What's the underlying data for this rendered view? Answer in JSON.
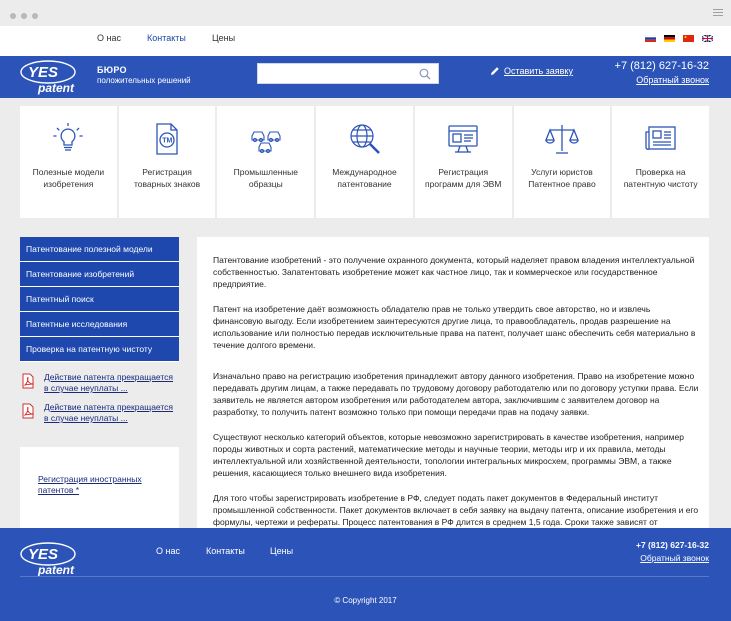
{
  "nav": {
    "about": "О нас",
    "contacts": "Контакты",
    "prices": "Цены"
  },
  "brand": {
    "logo_text_top": "YES",
    "logo_text_bottom": "patent",
    "title": "БЮРО",
    "subtitle": "положительных решений"
  },
  "header": {
    "request_label": "Оставить заявку",
    "phone": "+7 (812) 627-16-32",
    "callback": "Обратный звонок"
  },
  "services": [
    {
      "icon": "lightbulb-icon",
      "label": "Полезные модели изобретения"
    },
    {
      "icon": "trademark-document-icon",
      "label": "Регистрация товарных знаков"
    },
    {
      "icon": "cars-icon",
      "label": "Промышленные образцы"
    },
    {
      "icon": "globe-search-icon",
      "label": "Международное патентование"
    },
    {
      "icon": "computer-program-icon",
      "label": "Регистрация программ для ЭВМ"
    },
    {
      "icon": "scales-icon",
      "label": "Услуги юристов Патентное право"
    },
    {
      "icon": "newspaper-icon",
      "label": "Проверка на патентную чистоту"
    }
  ],
  "side_menu": [
    "Патентование полезной модели",
    "Патентование изобретений",
    "Патентный поиск",
    "Патентные исследования",
    "Проверка на патентную чистоту"
  ],
  "news": [
    {
      "line1": "Действие патента прекращается",
      "line2": "в случае неуплаты ..."
    },
    {
      "line1": "Действие патента прекращается",
      "line2": "в случае неуплаты ..."
    }
  ],
  "foreign": {
    "line1": "Регистрация иностранных",
    "line2": "патентов *"
  },
  "content": {
    "p1": "Патентование изобретений  - это получение охранного документа, который наделяет правом владения интеллектуальной собственностью. Запатентовать изобретение может как частное лицо, так и коммерческое или государственное предприятие.",
    "p2": "Патент на изобретение даёт возможность обладателю прав не только утвердить свое авторство, но и извлечь финансовую выгоду. Если изобретением заинтересуются другие лица, то правообладатель, продав разрешение на использование или полностью передав исключительные права на патент, получает шанс обеспечить себя материально в течение долгого времени.",
    "p3": "Изначально право на регистрацию изобретения принадлежит автору данного изобретения. Право на изобретение можно передавать другим лицам, а также передавать по трудовому договору работодателю  или по договору уступки права. Если заявитель не является автором изобретения или работодателем автора, заключившим с заявителем договор на разработку, то получить патент возможно только при помощи передачи прав на подачу заявки.",
    "p4": "Существуют несколько категорий объектов, которые невозможно зарегистрировать в качестве изобретения, например породы животных и сорта растений, математические методы и научные теории, методы игр и их правила, методы интеллектуальной или хозяйственной деятельности, топологии интегральных микросхем, программы ЭВМ, а также решения, касающиеся только внешнего вида изобретения.",
    "p5": "Для того чтобы зарегистрировать изобретение в РФ, следует подать пакет документов в Федеральный институт промышленной собственности. Пакет документов включает в себя заявку на выдачу патента, описание изобретения и его формулы, чертежи и рефераты. Процесс патентования в РФ длится в среднем 1,5 года. Сроки также зависят от"
  },
  "footer": {
    "about": "О нас",
    "contacts": "Контакты",
    "prices": "Цены",
    "phone": "+7 (812) 627-16-32",
    "callback": "Обратный звонок",
    "copyright": "© Copyright 2017"
  },
  "colors": {
    "brand_blue": "#2c54b8",
    "menu_blue": "#1e48ad",
    "link_dark": "#1a2a7a"
  }
}
